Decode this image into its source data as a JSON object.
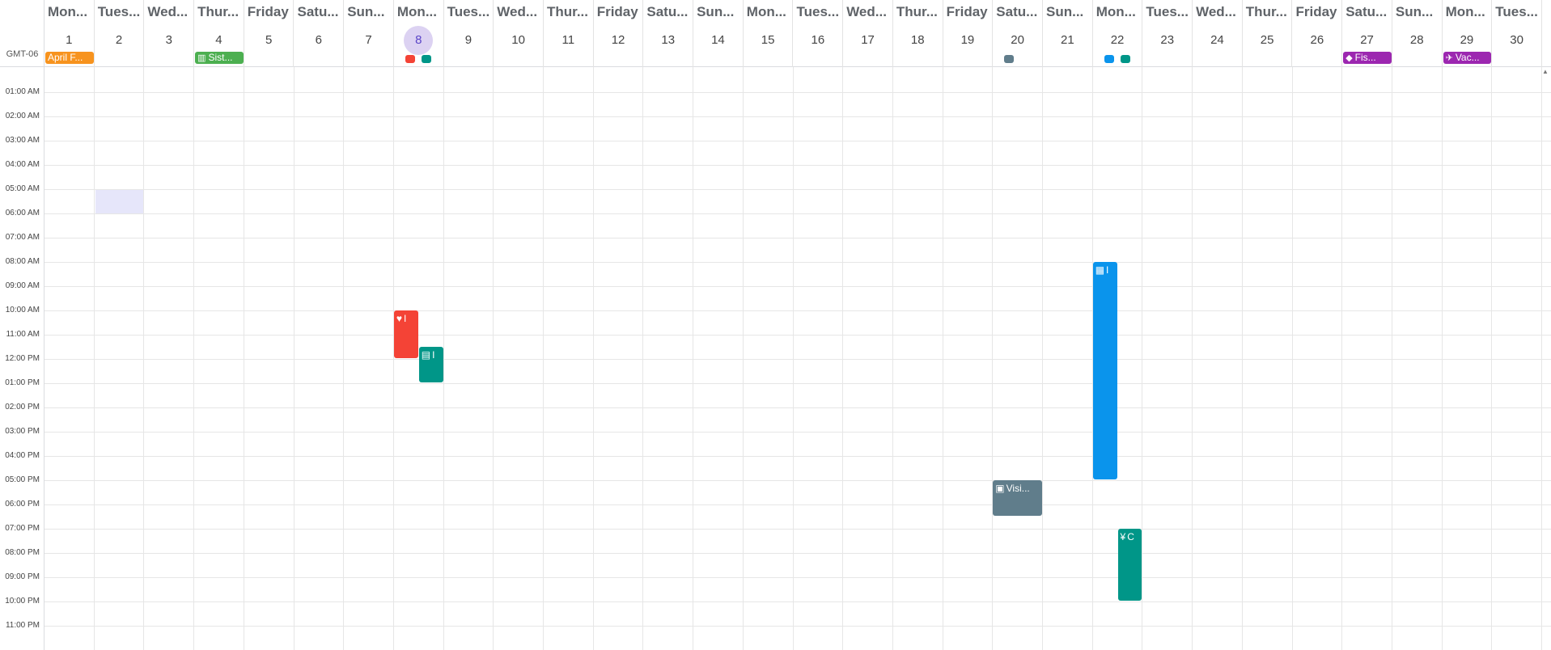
{
  "timezone_label": "GMT-06",
  "colors": {
    "orange": "#f7931e",
    "green": "#4caf50",
    "red": "#f44336",
    "teal": "#009688",
    "slate": "#607d8b",
    "blue": "#0a94ec",
    "purple": "#9c27b0",
    "today_bg": "#dcd2f2",
    "today_fg": "#5b45c8",
    "selection": "#e6e6fa"
  },
  "days": [
    {
      "name": "Mon...",
      "num": "1"
    },
    {
      "name": "Tues...",
      "num": "2"
    },
    {
      "name": "Wed...",
      "num": "3"
    },
    {
      "name": "Thur...",
      "num": "4"
    },
    {
      "name": "Friday",
      "num": "5"
    },
    {
      "name": "Satu...",
      "num": "6"
    },
    {
      "name": "Sun...",
      "num": "7"
    },
    {
      "name": "Mon...",
      "num": "8",
      "today": true
    },
    {
      "name": "Tues...",
      "num": "9"
    },
    {
      "name": "Wed...",
      "num": "10"
    },
    {
      "name": "Thur...",
      "num": "11"
    },
    {
      "name": "Friday",
      "num": "12"
    },
    {
      "name": "Satu...",
      "num": "13"
    },
    {
      "name": "Sun...",
      "num": "14"
    },
    {
      "name": "Mon...",
      "num": "15"
    },
    {
      "name": "Tues...",
      "num": "16"
    },
    {
      "name": "Wed...",
      "num": "17"
    },
    {
      "name": "Thur...",
      "num": "18"
    },
    {
      "name": "Friday",
      "num": "19"
    },
    {
      "name": "Satu...",
      "num": "20"
    },
    {
      "name": "Sun...",
      "num": "21"
    },
    {
      "name": "Mon...",
      "num": "22"
    },
    {
      "name": "Tues...",
      "num": "23"
    },
    {
      "name": "Wed...",
      "num": "24"
    },
    {
      "name": "Thur...",
      "num": "25"
    },
    {
      "name": "Friday",
      "num": "26"
    },
    {
      "name": "Satu...",
      "num": "27"
    },
    {
      "name": "Sun...",
      "num": "28"
    },
    {
      "name": "Mon...",
      "num": "29"
    },
    {
      "name": "Tues...",
      "num": "30"
    }
  ],
  "hours": [
    "01:00 AM",
    "02:00 AM",
    "03:00 AM",
    "04:00 AM",
    "05:00 AM",
    "06:00 AM",
    "07:00 AM",
    "08:00 AM",
    "09:00 AM",
    "10:00 AM",
    "11:00 AM",
    "12:00 PM",
    "01:00 PM",
    "02:00 PM",
    "03:00 PM",
    "04:00 PM",
    "05:00 PM",
    "06:00 PM",
    "07:00 PM",
    "08:00 PM",
    "09:00 PM",
    "10:00 PM",
    "11:00 PM"
  ],
  "all_day_events": [
    {
      "day": 1,
      "span": 1,
      "label": "April F...",
      "icon": "",
      "icon_name": "",
      "color": "orange"
    },
    {
      "day": 4,
      "span": 1,
      "label": "Sist...",
      "icon": "▥",
      "icon_name": "cake-icon",
      "color": "green"
    },
    {
      "day": 27,
      "span": 1,
      "label": "Fis...",
      "icon": "◆",
      "icon_name": "fish-icon",
      "color": "purple"
    },
    {
      "day": 29,
      "span": 1,
      "label": "Vac...",
      "icon": "✈",
      "icon_name": "airplane-icon",
      "color": "purple"
    }
  ],
  "all_day_dots": [
    {
      "day": 8,
      "slot": 0,
      "color": "red"
    },
    {
      "day": 8,
      "slot": 1,
      "color": "teal"
    },
    {
      "day": 20,
      "slot": 0,
      "color": "slate"
    },
    {
      "day": 22,
      "slot": 0,
      "color": "blue"
    },
    {
      "day": 22,
      "slot": 1,
      "color": "teal"
    }
  ],
  "selection": {
    "day": 2,
    "start": 5,
    "end": 6
  },
  "timed_events": [
    {
      "day": 8,
      "start": 10,
      "end": 12,
      "slot": 0,
      "slots": 2,
      "label": "I",
      "icon": "♥",
      "icon_name": "handshake-icon",
      "color": "red"
    },
    {
      "day": 8,
      "start": 11.5,
      "end": 13,
      "slot": 1,
      "slots": 2,
      "label": "I",
      "icon": "▤",
      "icon_name": "burger-icon",
      "color": "teal"
    },
    {
      "day": 20,
      "start": 17,
      "end": 18.5,
      "slot": 0,
      "slots": 1,
      "label": "Visi...",
      "icon": "▣",
      "icon_name": "car-icon",
      "color": "slate"
    },
    {
      "day": 22,
      "start": 8,
      "end": 17,
      "slot": 0,
      "slots": 2,
      "label": "I",
      "icon": "▦",
      "icon_name": "presentation-icon",
      "color": "blue"
    },
    {
      "day": 22,
      "start": 19,
      "end": 22,
      "slot": 1,
      "slots": 2,
      "label": "C",
      "icon": "¥",
      "icon_name": "utensils-icon",
      "color": "teal"
    }
  ]
}
